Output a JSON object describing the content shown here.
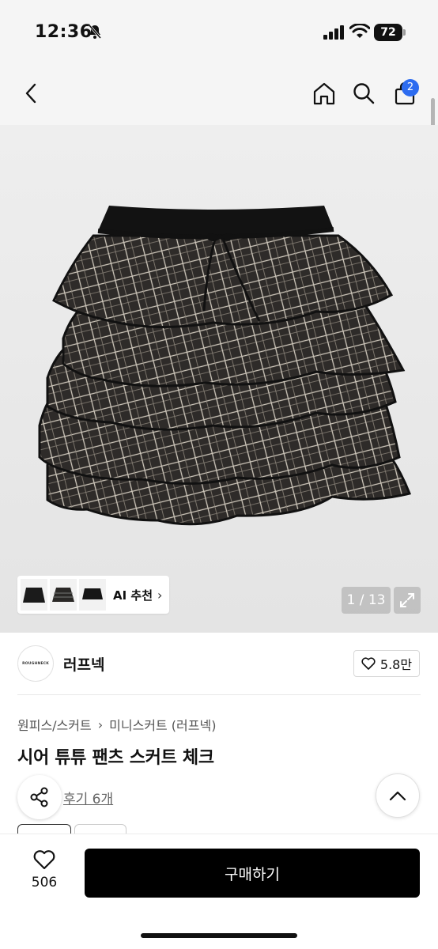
{
  "status_bar": {
    "time": "12:36",
    "battery": "72",
    "icons": [
      "bell-slash-icon",
      "signal-icon",
      "wifi-icon",
      "battery-icon"
    ]
  },
  "nav": {
    "icons": [
      "back-chevron-icon",
      "home-icon",
      "search-icon",
      "cart-icon"
    ],
    "cart_count": "2"
  },
  "gallery": {
    "counter": "1 / 13",
    "ai_recommend_label": "AI 추천",
    "thumbnails": [
      "skirt-thumb-1",
      "skirt-thumb-2",
      "skirt-thumb-3"
    ]
  },
  "shop": {
    "logo_text": "ROUGHNECK",
    "name": "러프넥",
    "likes": "5.8만"
  },
  "product": {
    "breadcrumb": [
      "원피스/스커트",
      "미니스커트 (러프넥)"
    ],
    "title": "시어 튜튜 팬츠 스커트 체크",
    "reviews": "후기 6개"
  },
  "bottom": {
    "wish_count": "506",
    "buy_label": "구매하기"
  },
  "colors": {
    "accent_badge": "#2d6cf0",
    "buy_button": "#000000"
  }
}
